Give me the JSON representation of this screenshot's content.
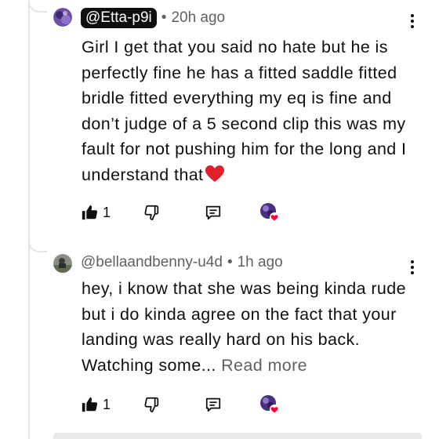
{
  "comments": [
    {
      "handle": "@Etta-p9i",
      "time": "20h ago",
      "text": "Girl I get that you said no hate but he is perfectly fine he has a fitted saddle fitted bridle fitted everything my eq is fine and don’t judge of a 5 second clip this was my fault for not pushing him for the long and I understand that",
      "emoji": "heart",
      "likes": "1"
    },
    {
      "handle": "@bellaandbenny-u4d",
      "time": "1h ago",
      "text": "hey, i know that she was being kinda rude but i do kinda agree on the fact that your landing was really hard on his back. Watching some...",
      "read_more": "Read more",
      "likes": "1"
    }
  ],
  "separator": "•",
  "colors": {
    "heart": "#e0202b",
    "creator_heart_badge": "#ff0033",
    "text": "#0f0f0f",
    "secondary": "#606060"
  },
  "icons": [
    "like-icon",
    "dislike-icon",
    "reply-icon",
    "creator-heart-icon",
    "more-options-icon"
  ]
}
